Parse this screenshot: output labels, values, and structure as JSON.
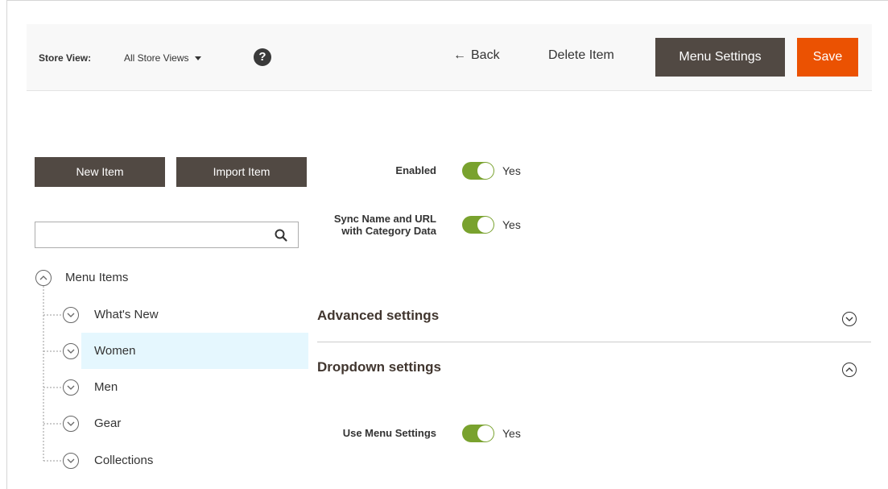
{
  "header": {
    "store_view_label": "Store View:",
    "store_view_value": "All Store Views",
    "help_label": "?",
    "back_label": "Back",
    "delete_label": "Delete Item",
    "menu_settings_label": "Menu Settings",
    "save_label": "Save"
  },
  "left": {
    "new_item_label": "New Item",
    "import_item_label": "Import Item",
    "search": {
      "value": "",
      "placeholder": ""
    },
    "tree": {
      "root_label": "Menu Items",
      "items": [
        {
          "label": "What's New"
        },
        {
          "label": "Women"
        },
        {
          "label": "Men"
        },
        {
          "label": "Gear"
        },
        {
          "label": "Collections"
        }
      ],
      "selected": "Women"
    }
  },
  "form": {
    "enabled": {
      "label": "Enabled",
      "value": "Yes"
    },
    "sync": {
      "label_line1": "Sync Name and URL",
      "label_line2": "with Category Data",
      "value": "Yes"
    },
    "advanced_title": "Advanced settings",
    "dropdown_title": "Dropdown settings",
    "use_menu_settings": {
      "label": "Use Menu Settings",
      "value": "Yes"
    }
  },
  "colors": {
    "dark_button": "#514943",
    "save_button": "#eb5202",
    "toggle_on": "#79a22e",
    "selected_row": "#e5f7fe"
  }
}
